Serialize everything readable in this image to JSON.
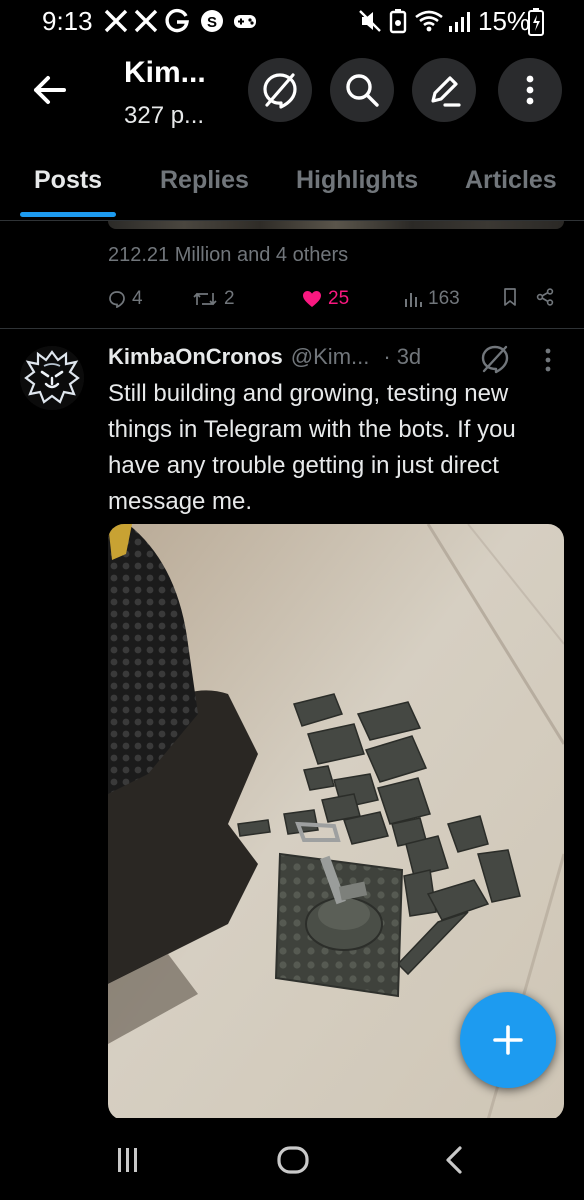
{
  "status_bar": {
    "time": "9:13",
    "battery": "15%",
    "left_icons": [
      "x-logo-icon",
      "x-logo-icon",
      "google-icon",
      "s-app-icon",
      "game-controller-icon"
    ],
    "right_icons": [
      "mute-icon",
      "battery-saver-icon",
      "wifi-icon",
      "signal-icon",
      "battery-icon"
    ]
  },
  "header": {
    "name": "Kim...",
    "post_count": "327 p...",
    "actions": [
      "hide-replies-icon",
      "search-icon",
      "edit-icon",
      "more-vertical-icon"
    ]
  },
  "tabs": [
    {
      "label": "Posts",
      "active": true
    },
    {
      "label": "Replies",
      "active": false
    },
    {
      "label": "Highlights",
      "active": false
    },
    {
      "label": "Articles",
      "active": false
    }
  ],
  "previous_post": {
    "reactions_text": "212.21 Million and 4 others",
    "stats": {
      "replies": "4",
      "reposts": "2",
      "likes": "25",
      "views": "163"
    },
    "like_color": "#f91880"
  },
  "post": {
    "author_name": "KimbaOnCronos",
    "author_handle": "@Kim...",
    "separator": "·",
    "time": "3d",
    "text": "Still building and growing, testing new things in Telegram with the bots. If you have any trouble getting in just direct message me.",
    "media_description_icon": "lego-bricks-photo"
  },
  "colors": {
    "accent": "#1d9bf0",
    "secondary_text": "#71767b",
    "divider": "#2f3336"
  },
  "fab": {
    "icon": "plus-icon"
  },
  "nav_bar": {
    "icons": [
      "recents-icon",
      "home-icon",
      "back-icon"
    ]
  }
}
